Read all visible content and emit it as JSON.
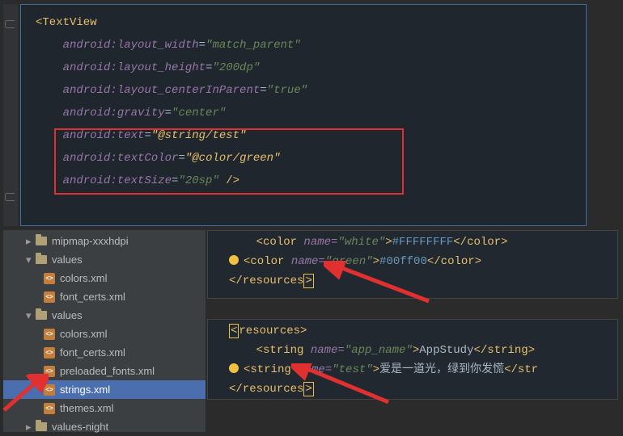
{
  "top_code": {
    "tag_open": "<TextView",
    "attrs": [
      {
        "ns": "android:",
        "name": "layout_width",
        "val": "\"match_parent\""
      },
      {
        "ns": "android:",
        "name": "layout_height",
        "val": "\"200dp\""
      },
      {
        "ns": "android:",
        "name": "layout_centerInParent",
        "val": "\"true\""
      },
      {
        "ns": "android:",
        "name": "gravity",
        "val": "\"center\""
      },
      {
        "ns": "android:",
        "name": "text",
        "val": "\"@string/test\""
      },
      {
        "ns": "android:",
        "name": "textColor",
        "val": "\"@color/green\""
      },
      {
        "ns": "android:",
        "name": "textSize",
        "val": "\"20sp\"",
        "close": " />"
      }
    ]
  },
  "tree": {
    "top": "mipmap-xxxhdpi",
    "folder1": "values",
    "files1": [
      "colors.xml",
      "font_certs.xml"
    ],
    "folder2": "values",
    "files2": [
      "colors.xml",
      "font_certs.xml",
      "preloaded_fonts.xml",
      "strings.xml",
      "themes.xml"
    ],
    "folder3": "values-night"
  },
  "panel2": {
    "line1": {
      "pre": "<color ",
      "attr": "name=",
      "val": "\"white\"",
      "mid": ">",
      "hex": "#FFFFFFFF",
      "end": "</color>"
    },
    "line2": {
      "pre": "<color ",
      "attr": "name=",
      "val": "\"green\"",
      "mid": ">",
      "hex": "#00ff00",
      "end": "</color>"
    },
    "closing": "</resources>"
  },
  "panel3": {
    "open": "<resources>",
    "line1": {
      "pre": "<string ",
      "attr": "name=",
      "val": "\"app_name\"",
      "mid": ">",
      "text": "AppStudy",
      "end": "</string>"
    },
    "line2": {
      "pre": "<string ",
      "attr": "name=",
      "val": "\"test\"",
      "mid": ">",
      "text": "爱是一道光，绿到你发慌",
      "end": "</str"
    },
    "closing": "</resources>"
  }
}
